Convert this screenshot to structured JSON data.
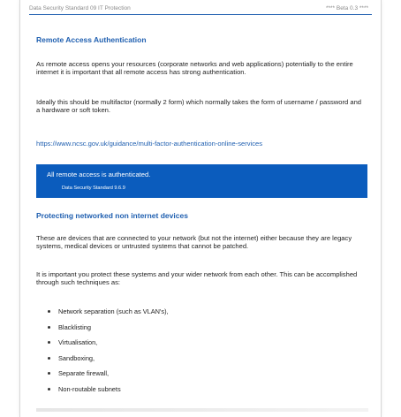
{
  "header": {
    "left": "Data Security Standard 09 IT Protection",
    "right": "**** Beta 0.3 ****"
  },
  "section1": {
    "title": "Remote Access Authentication",
    "para1": "As remote access opens your resources (corporate networks and web applications) potentially to the entire internet it is important that all remote access has strong authentication.",
    "para2": "Ideally this should be multifactor (normally 2 form) which normally takes the form of username / password and a hardware or soft token.",
    "link": "https://www.ncsc.gov.uk/guidance/multi-factor-authentication-online-services"
  },
  "callout": {
    "text": "All remote access is authenticated.",
    "ref": "Data Security Standard 9.6.9"
  },
  "section2": {
    "title": "Protecting networked non internet devices",
    "para1": "These are devices that are connected to your network (but not the internet) either because they are legacy systems, medical devices or untrusted systems that cannot be patched.",
    "para2": "It is important you protect these systems and your wider network from each other. This can be accomplished through such techniques as:",
    "techniques": [
      "Network separation (such as VLAN's),",
      "Blacklisting",
      "Virtualisation,",
      "Sandboxing,",
      "Separate firewall,",
      "Non-routable subnets"
    ]
  },
  "colors": {
    "accent": "#1f5fb0",
    "callout_bg": "#0b5cbd"
  }
}
